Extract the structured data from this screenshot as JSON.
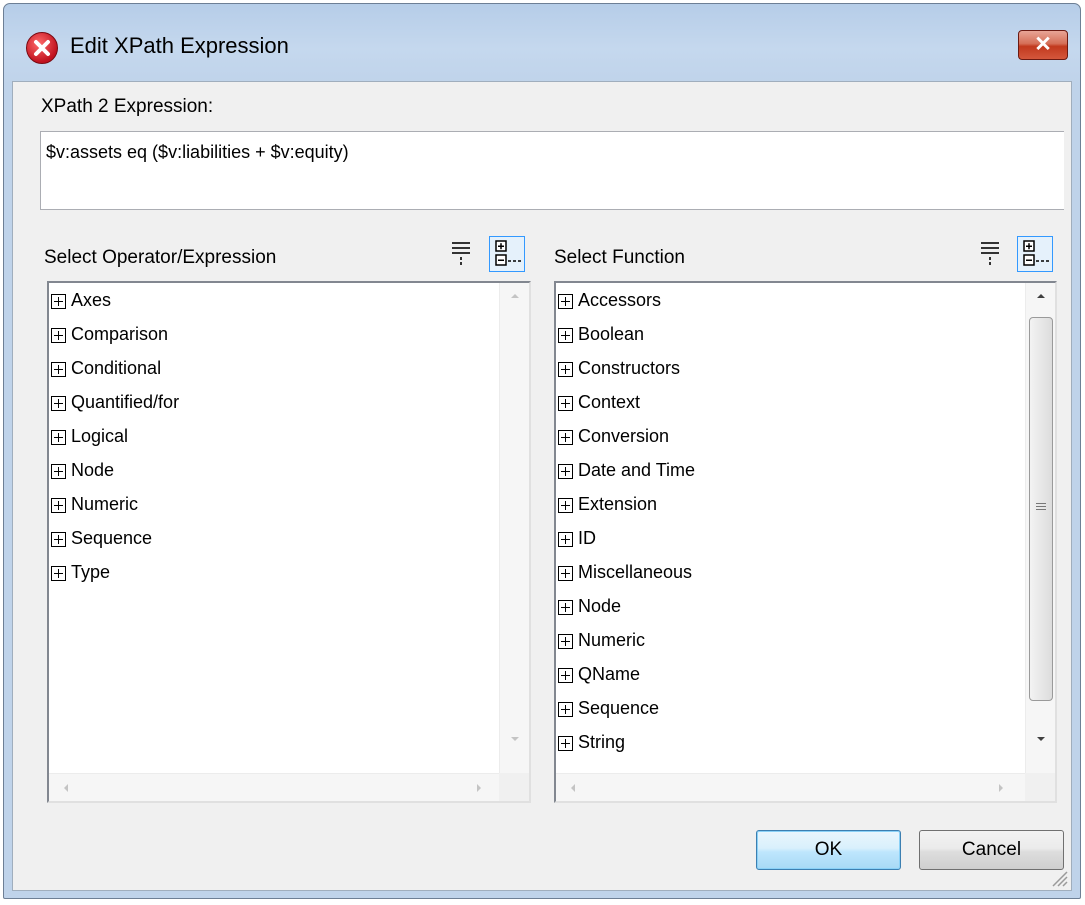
{
  "window": {
    "title": "Edit XPath Expression",
    "close_glyph": "✕"
  },
  "expression": {
    "label": "XPath 2 Expression:",
    "value": "$v:assets eq ($v:liabilities + $v:equity)"
  },
  "operator_panel": {
    "label": "Select Operator/Expression",
    "items": [
      "Axes",
      "Comparison",
      "Conditional",
      "Quantified/for",
      "Logical",
      "Node",
      "Numeric",
      "Sequence",
      "Type"
    ]
  },
  "function_panel": {
    "label": "Select Function",
    "items": [
      "Accessors",
      "Boolean",
      "Constructors",
      "Context",
      "Conversion",
      "Date and Time",
      "Extension",
      "ID",
      "Miscellaneous",
      "Node",
      "Numeric",
      "QName",
      "Sequence",
      "String"
    ]
  },
  "buttons": {
    "ok": "OK",
    "cancel": "Cancel"
  },
  "icons": {
    "app": "altova-xpath-icon",
    "show_description": "show-description-icon",
    "tree_view": "tree-view-icon"
  },
  "colors": {
    "close_button": "#c1391e",
    "selected_tool_border": "#3399ff",
    "ok_border": "#3c7fb1"
  }
}
